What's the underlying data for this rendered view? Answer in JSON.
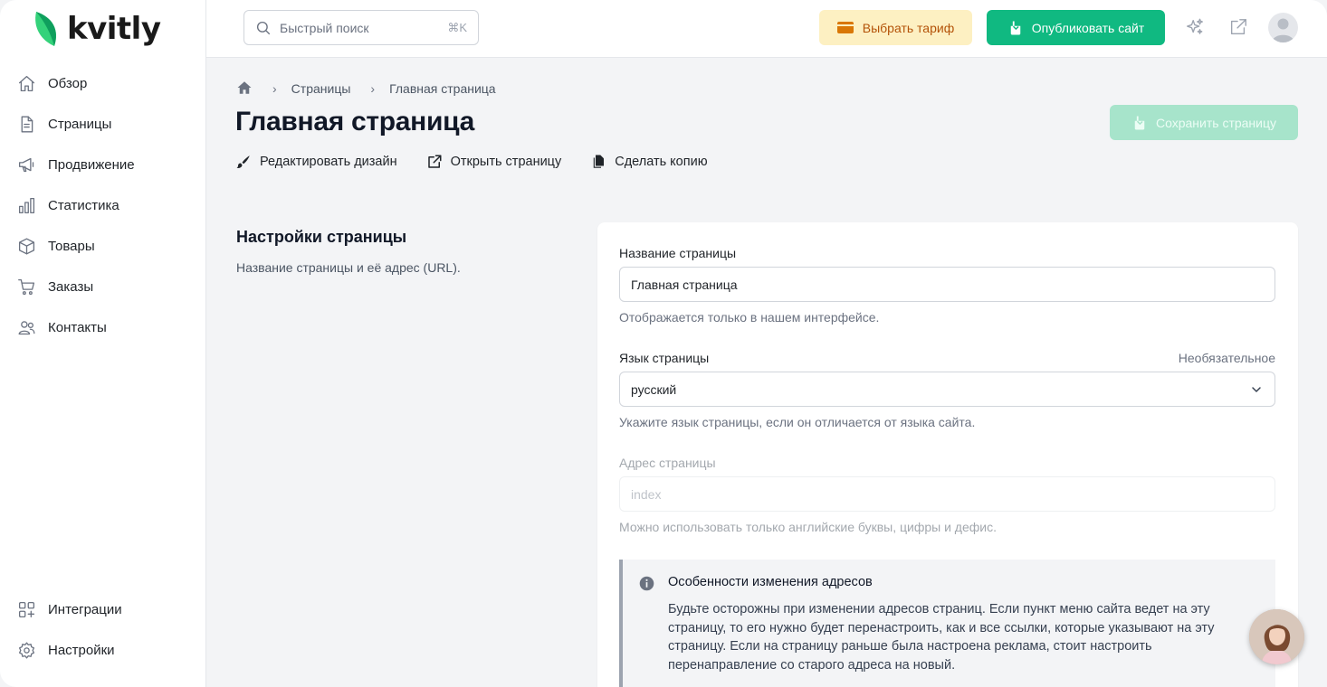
{
  "brand": {
    "name": "kvitly",
    "accent": "#10b981",
    "leaf_dark": "#0f9f5d",
    "leaf_light": "#34d27a"
  },
  "sidebar": {
    "items": [
      {
        "label": "Обзор",
        "icon": "home-icon"
      },
      {
        "label": "Страницы",
        "icon": "document-icon"
      },
      {
        "label": "Продвижение",
        "icon": "megaphone-icon"
      },
      {
        "label": "Статистика",
        "icon": "bar-chart-icon"
      },
      {
        "label": "Товары",
        "icon": "box-icon"
      },
      {
        "label": "Заказы",
        "icon": "cart-icon"
      },
      {
        "label": "Контакты",
        "icon": "users-icon"
      }
    ],
    "bottom_items": [
      {
        "label": "Интеграции",
        "icon": "grid-plus-icon"
      },
      {
        "label": "Настройки",
        "icon": "gear-icon"
      }
    ]
  },
  "topbar": {
    "search_placeholder": "Быстрый поиск",
    "search_shortcut": "⌘K",
    "tariff_button": "Выбрать тариф",
    "publish_button": "Опубликовать сайт"
  },
  "breadcrumb": {
    "items": [
      "Страницы",
      "Главная страница"
    ]
  },
  "page": {
    "title": "Главная страница",
    "save_button": "Сохранить страницу",
    "actions": [
      "Редактировать дизайн",
      "Открыть страницу",
      "Сделать копию"
    ]
  },
  "settings": {
    "title": "Настройки страницы",
    "description": "Название страницы и её адрес (URL).",
    "name_label": "Название страницы",
    "name_value": "Главная страница",
    "name_help": "Отображается только в нашем интерфейсе.",
    "lang_label": "Язык страницы",
    "lang_optional": "Необязательное",
    "lang_value": "русский",
    "lang_help": "Укажите язык страницы, если он отличается от языка сайта.",
    "address_label": "Адрес страницы",
    "address_placeholder": "index",
    "address_help": "Можно использовать только английские буквы, цифры и дефис."
  },
  "notice": {
    "title": "Особенности изменения адресов",
    "text": "Будьте осторожны при изменении адресов страниц. Если пункт меню сайта ведет на эту страницу, то его нужно будет перенастроить, как и все ссылки, которые указывают на эту страницу. Если на страницу раньше была настроена реклама, стоит настроить перенаправление со старого адреса на новый."
  }
}
